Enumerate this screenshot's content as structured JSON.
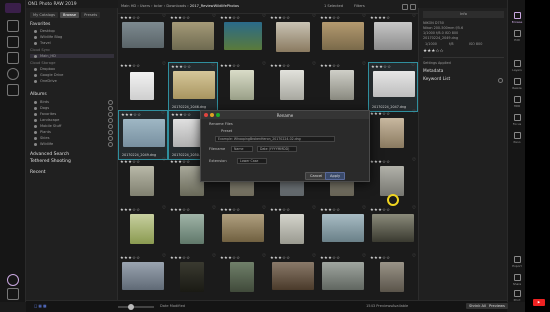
{
  "app": {
    "title": "ON1 Photo RAW 2019"
  },
  "sidebar": {
    "tabs": [
      "My Catalogs",
      "Browse",
      "Presets"
    ],
    "active_tab": "Browse",
    "favorites_header": "Favorites",
    "favorites": [
      {
        "label": "Desktop"
      },
      {
        "label": "Wildlife Blog"
      },
      {
        "label": "Travel"
      }
    ],
    "cloud_header": "Cloud Sync",
    "cloud_items": [
      {
        "label": "Main_HD",
        "selected": true
      }
    ],
    "cloud_header2": "Cloud Storage",
    "cloud_services": [
      {
        "label": "Dropbox"
      },
      {
        "label": "Google Drive"
      },
      {
        "label": "OneDrive"
      }
    ],
    "albums_header": "Albums",
    "albums": [
      {
        "label": "Birds"
      },
      {
        "label": "Dogs"
      },
      {
        "label": "Favorites"
      },
      {
        "label": "Landscape"
      },
      {
        "label": "Mobile Stuff"
      },
      {
        "label": "Plants"
      },
      {
        "label": "Skies"
      },
      {
        "label": "Wildlife"
      }
    ],
    "advanced_search": "Advanced Search",
    "tethered": "Tethered Shooting",
    "recent": "Recent"
  },
  "toolbar": {
    "breadcrumb_prefix": "Main HD › Users › bclar › Downloads › ",
    "breadcrumb_current": "2017_ReviewWildlifePhotos",
    "selected": "1 Selected",
    "filters": "Filters"
  },
  "grid": {
    "stars": "★★★☆☆",
    "stars4": "★★★★☆",
    "selected_files": [
      "20170224_2046.dng",
      "20170224_2047.dng",
      "20170224_2049.dng",
      "20170224_2050.dng"
    ]
  },
  "dialog": {
    "title": "Rename",
    "section": "Rename Files",
    "preset_label": "Preset",
    "example": "Example: WhoopingBrokenHeron_20170224-02.dng",
    "filename_label": "Filename",
    "filename_token": "Name",
    "filename_value": "Date (YYYYMMDD)",
    "sequence_label": "Extension",
    "sequence_value": "Lower Case",
    "cancel": "Cancel",
    "apply": "Apply"
  },
  "bottombar": {
    "zoom_label": "Date Modified",
    "count": "1543 Previews",
    "status": "Available",
    "btn1": "Shrink All",
    "btn2": "Previews"
  },
  "right_panel": {
    "histogram_label": "Info",
    "info_lines": [
      "NIKON D750",
      "Nikon 200-500mm f/5.6",
      "1/1000 f/8.0 ISO 800",
      "20170224_2049.dng"
    ],
    "info_row": [
      "1/1000",
      "f/8",
      "ISO 800"
    ],
    "stars": "★★★☆☆",
    "settings_applied": "Settings Applied",
    "metadata": "Metadata",
    "keyword_list": "Keyword List"
  },
  "right_rail": [
    {
      "label": "Browse",
      "icon": "browse-icon",
      "active": true
    },
    {
      "label": "Edit",
      "icon": "edit-icon"
    },
    {
      "label": "Layers",
      "icon": "layers-icon"
    },
    {
      "label": "Resize",
      "icon": "resize-icon"
    },
    {
      "label": "HDR",
      "icon": "hdr-icon"
    },
    {
      "label": "Focus",
      "icon": "focus-icon"
    },
    {
      "label": "Pano",
      "icon": "pano-icon"
    },
    {
      "label": "Export",
      "icon": "export-icon"
    },
    {
      "label": "Share",
      "icon": "share-icon"
    },
    {
      "label": "Print",
      "icon": "print-icon"
    }
  ],
  "colors": {
    "accent": "#c9a7e0",
    "selection": "#2f8f9e",
    "cursor": "#f0d520"
  }
}
